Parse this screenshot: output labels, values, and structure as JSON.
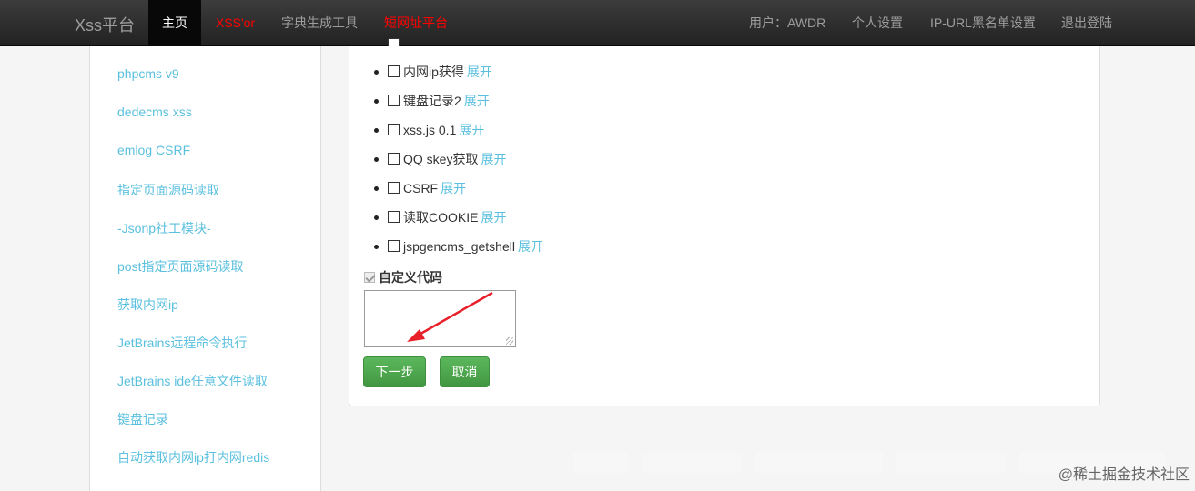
{
  "navbar": {
    "brand": "Xss平台",
    "items": [
      {
        "label": "主页",
        "state": "active"
      },
      {
        "label": "XSS'or",
        "state": "red"
      },
      {
        "label": "字典生成工具",
        "state": "normal"
      },
      {
        "label": "短网址平台",
        "state": "red"
      }
    ],
    "user_label": "用户：AWDR",
    "settings_label": "个人设置",
    "blacklist_label": "IP-URL黑名单设置",
    "logout_label": "退出登陆"
  },
  "sidebar": {
    "items": [
      "phpcms v9",
      "dedecms xss",
      "emlog CSRF",
      "指定页面源码读取",
      "-Jsonp社工模块-",
      "post指定页面源码读取",
      "获取内网ip",
      "JetBrains远程命令执行",
      "JetBrains ide任意文件读取",
      "键盘记录",
      "自动获取内网ip打内网redis"
    ]
  },
  "modules": {
    "expand_label": "展开",
    "items": [
      {
        "name": "内网ip获得",
        "checked": false
      },
      {
        "name": "键盘记录2",
        "checked": false
      },
      {
        "name": "xss.js 0.1",
        "checked": false
      },
      {
        "name": "QQ skey获取",
        "checked": false
      },
      {
        "name": "CSRF",
        "checked": false
      },
      {
        "name": "读取COOKIE",
        "checked": false
      },
      {
        "name": "jspgencms_getshell",
        "checked": false
      }
    ]
  },
  "custom_code": {
    "label": "自定义代码",
    "checked": true,
    "value": ""
  },
  "buttons": {
    "next": "下一步",
    "cancel": "取消"
  },
  "annotation": {
    "arrow_color": "#e8202a"
  },
  "watermark": {
    "corner_text": "@稀土掘金技术社区"
  }
}
